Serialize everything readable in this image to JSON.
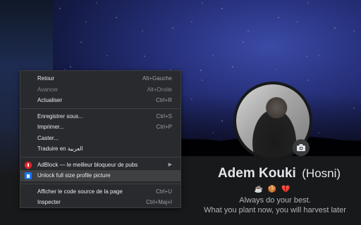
{
  "profile": {
    "name": "Adem Kouki",
    "nickname": "(Hosni)",
    "emojis": "☕ 🍪 💔",
    "bio_line1": "Always do your best.",
    "bio_line2": "What you plant now, you will harvest later"
  },
  "context_menu": {
    "items": [
      {
        "label": "Retour",
        "shortcut": "Alt+Gauche"
      },
      {
        "label": "Avancer",
        "shortcut": "Alt+Droite"
      },
      {
        "label": "Actualiser",
        "shortcut": "Ctrl+R"
      },
      {
        "label": "Enregistrer sous...",
        "shortcut": "Ctrl+S"
      },
      {
        "label": "Imprimer...",
        "shortcut": "Ctrl+P"
      },
      {
        "label": "Caster...",
        "shortcut": ""
      },
      {
        "label": "Traduire en العربية",
        "shortcut": ""
      },
      {
        "label": "AdBlock — le meilleur bloqueur de pubs",
        "shortcut": ""
      },
      {
        "label": "Unlock full size profile picture",
        "shortcut": ""
      },
      {
        "label": "Afficher le code source de la page",
        "shortcut": "Ctrl+U"
      },
      {
        "label": "Inspecter",
        "shortcut": "Ctrl+Maj+I"
      }
    ]
  },
  "colors": {
    "background": "#18191a",
    "menu_bg": "#292a2d",
    "menu_highlight": "#3f4042",
    "adblock_red": "#e0242a",
    "extension_blue": "#1877f2"
  },
  "icons": {
    "camera": "camera-icon",
    "adblock": "adblock-icon",
    "unlock": "unlock-extension-icon",
    "submenu": "chevron-right-icon"
  }
}
